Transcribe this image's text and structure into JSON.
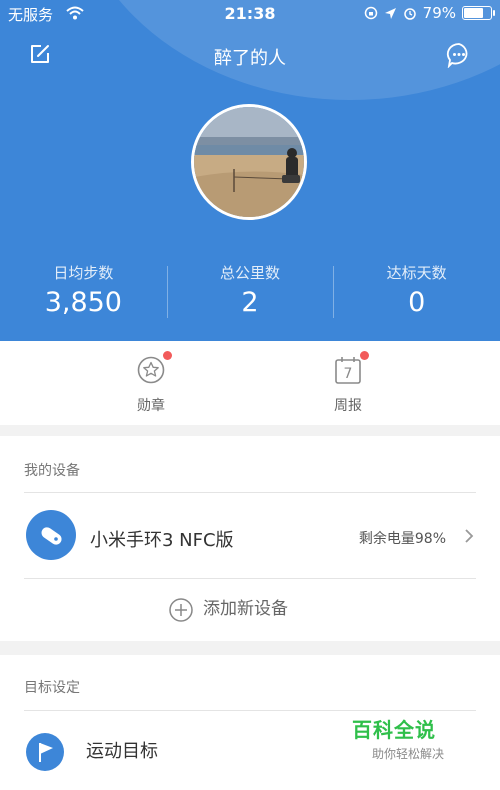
{
  "status_bar": {
    "carrier": "无服务",
    "time": "21:38",
    "battery_percent": "79%",
    "battery_level": 0.79
  },
  "header": {
    "title": "醉了的人",
    "background_color": "#3d86d8"
  },
  "stats": [
    {
      "label": "日均步数",
      "value": "3,850"
    },
    {
      "label": "总公里数",
      "value": "2"
    },
    {
      "label": "达标天数",
      "value": "0"
    }
  ],
  "quick_actions": [
    {
      "label": "勋章",
      "icon": "medal-star-icon",
      "has_badge": true
    },
    {
      "label": "周报",
      "icon": "calendar-icon",
      "icon_text": "7",
      "has_badge": true
    }
  ],
  "devices": {
    "section_title": "我的设备",
    "items": [
      {
        "name": "小米手环3 NFC版",
        "battery": "剩余电量98%",
        "icon": "band-icon"
      }
    ],
    "add_label": "添加新设备"
  },
  "goals": {
    "section_title": "目标设定",
    "items": [
      {
        "name": "运动目标",
        "icon": "flag-icon"
      }
    ]
  },
  "watermark": {
    "title": "百科全说",
    "subtitle": "助你轻松解决"
  },
  "colors": {
    "accent": "#3d86d8",
    "badge": "#f25b5b",
    "watermark": "#2fbf4a"
  }
}
